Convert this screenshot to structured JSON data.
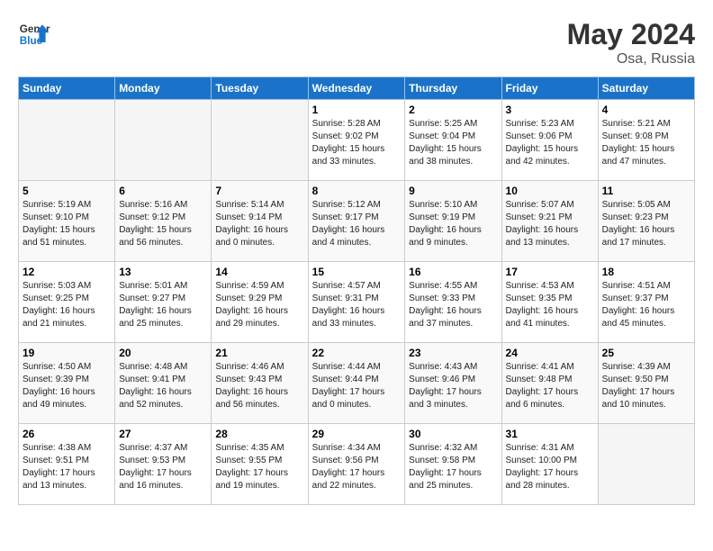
{
  "header": {
    "logo_line1": "General",
    "logo_line2": "Blue",
    "month_year": "May 2024",
    "location": "Osa, Russia"
  },
  "columns": [
    "Sunday",
    "Monday",
    "Tuesday",
    "Wednesday",
    "Thursday",
    "Friday",
    "Saturday"
  ],
  "weeks": [
    [
      {
        "day": "",
        "info": ""
      },
      {
        "day": "",
        "info": ""
      },
      {
        "day": "",
        "info": ""
      },
      {
        "day": "1",
        "info": "Sunrise: 5:28 AM\nSunset: 9:02 PM\nDaylight: 15 hours\nand 33 minutes."
      },
      {
        "day": "2",
        "info": "Sunrise: 5:25 AM\nSunset: 9:04 PM\nDaylight: 15 hours\nand 38 minutes."
      },
      {
        "day": "3",
        "info": "Sunrise: 5:23 AM\nSunset: 9:06 PM\nDaylight: 15 hours\nand 42 minutes."
      },
      {
        "day": "4",
        "info": "Sunrise: 5:21 AM\nSunset: 9:08 PM\nDaylight: 15 hours\nand 47 minutes."
      }
    ],
    [
      {
        "day": "5",
        "info": "Sunrise: 5:19 AM\nSunset: 9:10 PM\nDaylight: 15 hours\nand 51 minutes."
      },
      {
        "day": "6",
        "info": "Sunrise: 5:16 AM\nSunset: 9:12 PM\nDaylight: 15 hours\nand 56 minutes."
      },
      {
        "day": "7",
        "info": "Sunrise: 5:14 AM\nSunset: 9:14 PM\nDaylight: 16 hours\nand 0 minutes."
      },
      {
        "day": "8",
        "info": "Sunrise: 5:12 AM\nSunset: 9:17 PM\nDaylight: 16 hours\nand 4 minutes."
      },
      {
        "day": "9",
        "info": "Sunrise: 5:10 AM\nSunset: 9:19 PM\nDaylight: 16 hours\nand 9 minutes."
      },
      {
        "day": "10",
        "info": "Sunrise: 5:07 AM\nSunset: 9:21 PM\nDaylight: 16 hours\nand 13 minutes."
      },
      {
        "day": "11",
        "info": "Sunrise: 5:05 AM\nSunset: 9:23 PM\nDaylight: 16 hours\nand 17 minutes."
      }
    ],
    [
      {
        "day": "12",
        "info": "Sunrise: 5:03 AM\nSunset: 9:25 PM\nDaylight: 16 hours\nand 21 minutes."
      },
      {
        "day": "13",
        "info": "Sunrise: 5:01 AM\nSunset: 9:27 PM\nDaylight: 16 hours\nand 25 minutes."
      },
      {
        "day": "14",
        "info": "Sunrise: 4:59 AM\nSunset: 9:29 PM\nDaylight: 16 hours\nand 29 minutes."
      },
      {
        "day": "15",
        "info": "Sunrise: 4:57 AM\nSunset: 9:31 PM\nDaylight: 16 hours\nand 33 minutes."
      },
      {
        "day": "16",
        "info": "Sunrise: 4:55 AM\nSunset: 9:33 PM\nDaylight: 16 hours\nand 37 minutes."
      },
      {
        "day": "17",
        "info": "Sunrise: 4:53 AM\nSunset: 9:35 PM\nDaylight: 16 hours\nand 41 minutes."
      },
      {
        "day": "18",
        "info": "Sunrise: 4:51 AM\nSunset: 9:37 PM\nDaylight: 16 hours\nand 45 minutes."
      }
    ],
    [
      {
        "day": "19",
        "info": "Sunrise: 4:50 AM\nSunset: 9:39 PM\nDaylight: 16 hours\nand 49 minutes."
      },
      {
        "day": "20",
        "info": "Sunrise: 4:48 AM\nSunset: 9:41 PM\nDaylight: 16 hours\nand 52 minutes."
      },
      {
        "day": "21",
        "info": "Sunrise: 4:46 AM\nSunset: 9:43 PM\nDaylight: 16 hours\nand 56 minutes."
      },
      {
        "day": "22",
        "info": "Sunrise: 4:44 AM\nSunset: 9:44 PM\nDaylight: 17 hours\nand 0 minutes."
      },
      {
        "day": "23",
        "info": "Sunrise: 4:43 AM\nSunset: 9:46 PM\nDaylight: 17 hours\nand 3 minutes."
      },
      {
        "day": "24",
        "info": "Sunrise: 4:41 AM\nSunset: 9:48 PM\nDaylight: 17 hours\nand 6 minutes."
      },
      {
        "day": "25",
        "info": "Sunrise: 4:39 AM\nSunset: 9:50 PM\nDaylight: 17 hours\nand 10 minutes."
      }
    ],
    [
      {
        "day": "26",
        "info": "Sunrise: 4:38 AM\nSunset: 9:51 PM\nDaylight: 17 hours\nand 13 minutes."
      },
      {
        "day": "27",
        "info": "Sunrise: 4:37 AM\nSunset: 9:53 PM\nDaylight: 17 hours\nand 16 minutes."
      },
      {
        "day": "28",
        "info": "Sunrise: 4:35 AM\nSunset: 9:55 PM\nDaylight: 17 hours\nand 19 minutes."
      },
      {
        "day": "29",
        "info": "Sunrise: 4:34 AM\nSunset: 9:56 PM\nDaylight: 17 hours\nand 22 minutes."
      },
      {
        "day": "30",
        "info": "Sunrise: 4:32 AM\nSunset: 9:58 PM\nDaylight: 17 hours\nand 25 minutes."
      },
      {
        "day": "31",
        "info": "Sunrise: 4:31 AM\nSunset: 10:00 PM\nDaylight: 17 hours\nand 28 minutes."
      },
      {
        "day": "",
        "info": ""
      }
    ]
  ]
}
